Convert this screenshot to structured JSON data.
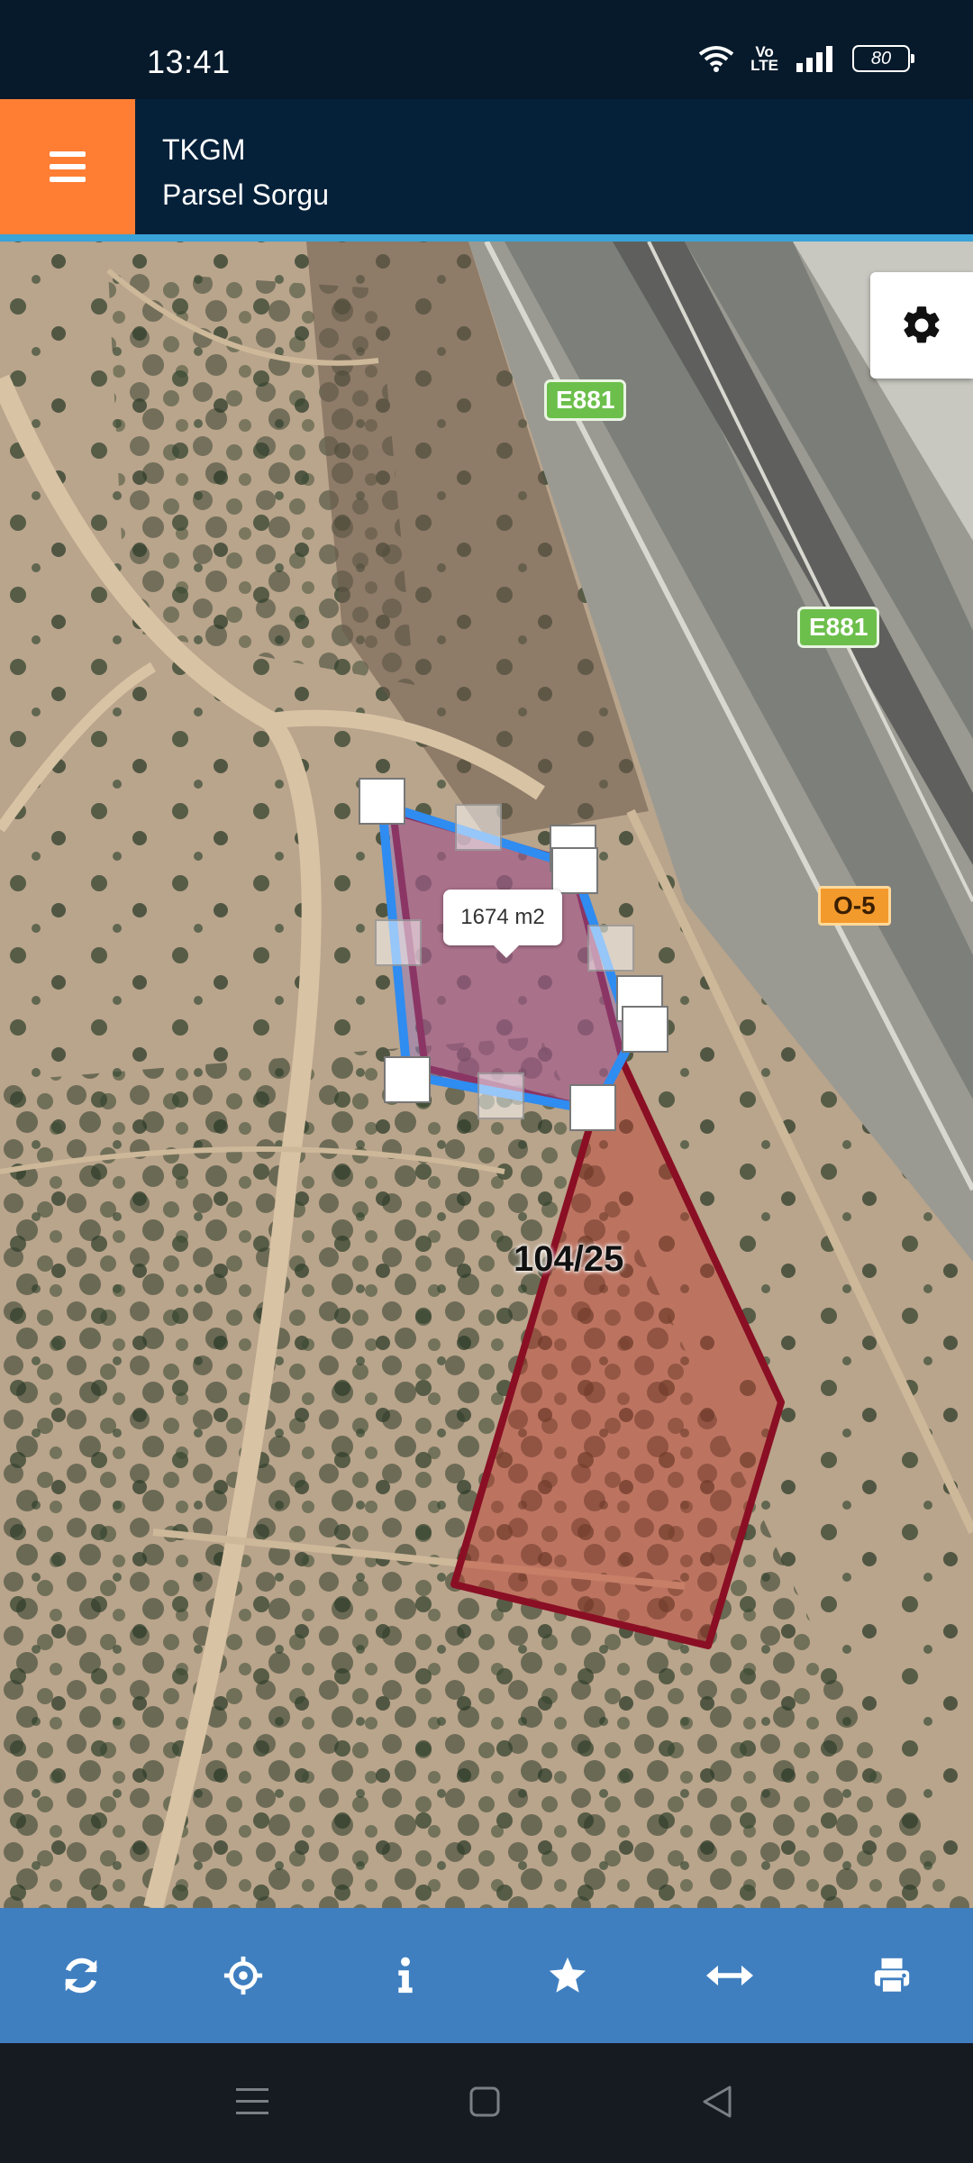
{
  "status_bar": {
    "time": "13:41",
    "network_label_top": "Vo",
    "network_label_bottom": "LTE",
    "battery_level": "80"
  },
  "header": {
    "title": "TKGM",
    "subtitle": "Parsel Sorgu",
    "menu_icon": "hamburger-icon",
    "background": "#05213a",
    "accent": "#ff7e34"
  },
  "map": {
    "road_signs": [
      "E881",
      "E881"
    ],
    "route_sign": "O-5",
    "area_tooltip": "1674 m2",
    "parcel_label": "104/25",
    "settings_icon": "gear-icon"
  },
  "toolbar": {
    "background": "#3f7fc0",
    "items": [
      {
        "name": "refresh",
        "icon": "refresh-icon"
      },
      {
        "name": "locate",
        "icon": "crosshair-icon"
      },
      {
        "name": "info",
        "icon": "info-icon"
      },
      {
        "name": "favorite",
        "icon": "star-icon"
      },
      {
        "name": "measure",
        "icon": "horizontal-arrows-icon"
      },
      {
        "name": "print",
        "icon": "printer-icon"
      }
    ]
  },
  "nav_bar": {
    "items": [
      "menu-nav-icon",
      "home-nav-icon",
      "back-nav-icon"
    ]
  }
}
